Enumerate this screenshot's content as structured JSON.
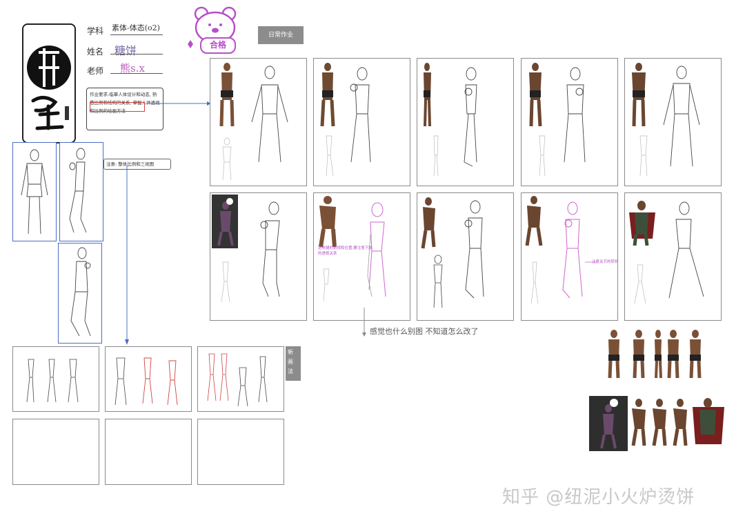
{
  "header": {
    "course_label": "学科",
    "course_value": "素体-体态(o2)",
    "name_label": "姓名",
    "name_value": "糖饼",
    "teacher_label": "老师",
    "teacher_value": "熊s.x",
    "sticker_text": "合格",
    "tag_text": "日常作业"
  },
  "notes": {
    "task_note": "作业要求:临摹人体设计和动态, 熟悉比例和结构的关系, 掌握人体透视和比例的绘画方法",
    "side_note": "注意: 整体比例和三视图",
    "arrow_note": "感觉也什么别图 不知道怎么改了",
    "pink_note": "这条腿的透视和位置,要注意下肢的透视关系",
    "pink_note2": "注意关节的转折"
  },
  "small_tag": "新 画 法",
  "watermark": "知乎 @纽泥小火炉烫饼",
  "colors": {
    "accent_blue": "#4a6cc4",
    "pink": "#cc66cc",
    "red": "#d04040",
    "tag_grey": "#8c8c8c"
  }
}
